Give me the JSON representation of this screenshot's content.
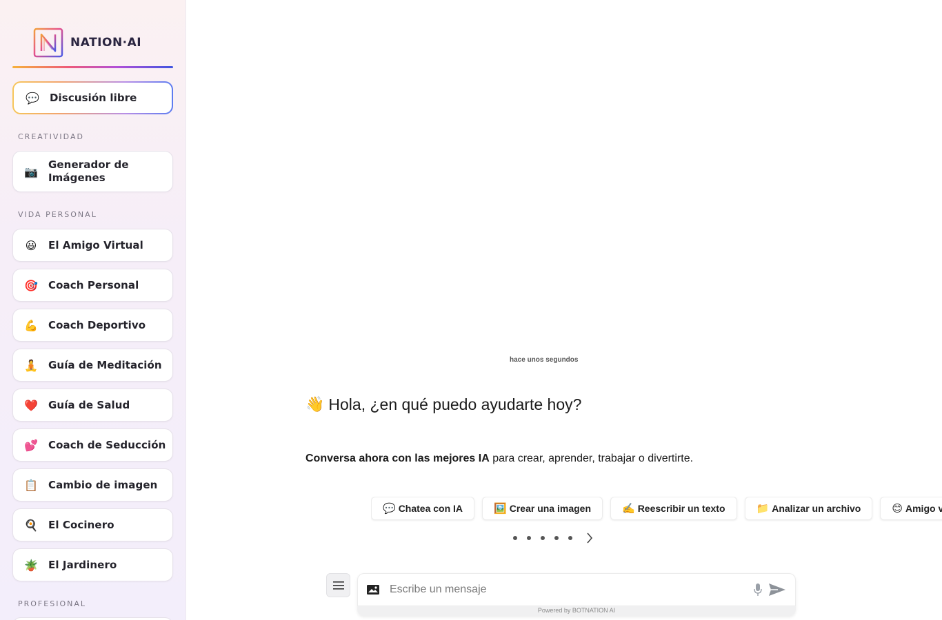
{
  "brand": {
    "name": "NATION·AI",
    "logo_letter": "N"
  },
  "sidebar": {
    "free_discussion": {
      "label": "Discusión libre",
      "icon": "💬"
    },
    "sections": [
      {
        "title": "CREATIVIDAD"
      },
      {
        "title": "VIDA PERSONAL"
      },
      {
        "title": "PROFESIONAL"
      }
    ],
    "creativity_items": [
      {
        "label": "Generador de Imágenes",
        "icon": "📷"
      }
    ],
    "personal_items": [
      {
        "label": "El Amigo Virtual",
        "icon": "😃"
      },
      {
        "label": "Coach Personal",
        "icon": "🎯"
      },
      {
        "label": "Coach Deportivo",
        "icon": "💪"
      },
      {
        "label": "Guía de Meditación",
        "icon": "🧘"
      },
      {
        "label": "Guía de Salud",
        "icon": "❤️"
      },
      {
        "label": "Coach de Seducción",
        "icon": "💕"
      },
      {
        "label": "Cambio de imagen",
        "icon": "📋"
      },
      {
        "label": "El Cocinero",
        "icon": "🍳"
      },
      {
        "label": "El Jardinero",
        "icon": "🪴"
      }
    ]
  },
  "chat": {
    "timestamp": "hace unos segundos",
    "greeting_icon": "👋",
    "greeting": "Hola, ¿en qué puedo ayudarte hoy?",
    "subtitle_bold": "Conversa ahora con las mejores IA",
    "subtitle_rest": " para crear, aprender, trabajar o divertirte.",
    "suggestions": [
      {
        "icon": "💬",
        "label": "Chatea con IA"
      },
      {
        "icon": "🖼️",
        "label": "Crear una imagen"
      },
      {
        "icon": "✍️",
        "label": "Reescribir un texto"
      },
      {
        "icon": "📁",
        "label": "Analizar un archivo"
      },
      {
        "icon": "😊",
        "label": "Amigo virtual"
      }
    ],
    "carousel_pages": 5
  },
  "composer": {
    "placeholder": "Escribe un mensaje",
    "powered_by": "Powered by BOTNATION AI",
    "icons": [
      "menu-icon",
      "image-icon",
      "microphone-icon",
      "send-icon"
    ]
  },
  "colors": {
    "brand_gradient": [
      "#f6b23a",
      "#ee5a7a",
      "#b24fd8",
      "#3f55e0"
    ]
  }
}
